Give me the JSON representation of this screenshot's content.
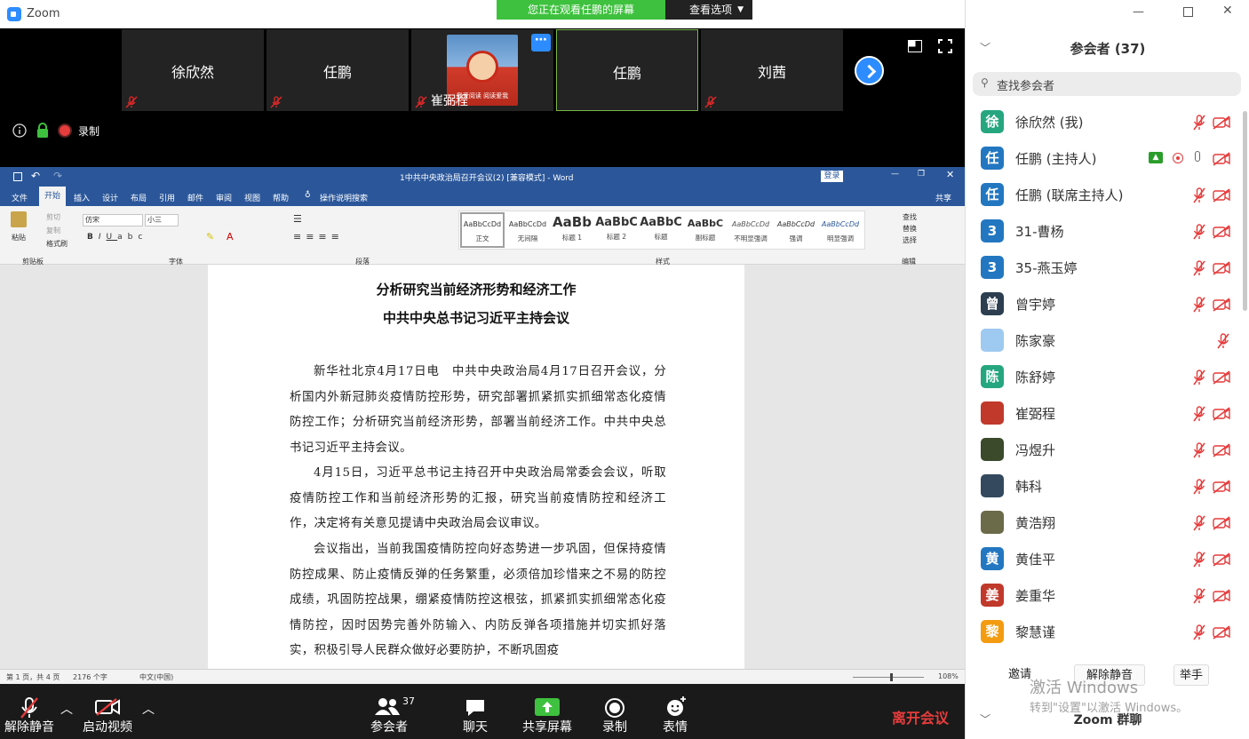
{
  "window": {
    "app_name": "Zoom"
  },
  "share_banner": {
    "text": "您正在观看任鹏的屏幕",
    "view_options": "查看选项"
  },
  "video_tiles": [
    {
      "name": "徐欣然"
    },
    {
      "name": "任鹏"
    },
    {
      "name": "崔弼程",
      "overlay": "我爱阅读 阅读爱我"
    },
    {
      "name": "任鹏"
    },
    {
      "name": "刘茜"
    }
  ],
  "meeting_info": {
    "record_label": "录制"
  },
  "word": {
    "title": "1中共中央政治局召开会议(2) [兼容模式] - Word",
    "login": "登录",
    "share": "共享",
    "tabs": [
      "文件",
      "开始",
      "插入",
      "设计",
      "布局",
      "引用",
      "邮件",
      "审阅",
      "视图",
      "帮助",
      "操作说明搜索"
    ],
    "font_name": "仿宋",
    "font_size": "小三",
    "styles": [
      "正文",
      "无间隔",
      "标题 1",
      "标题 2",
      "标题",
      "副标题",
      "不明显强调",
      "强调",
      "明显强调"
    ],
    "style_previews": [
      "AaBbCcDd",
      "AaBbCcDd",
      "AaBb",
      "AaBbC",
      "AaBbC",
      "AaBbC",
      "AaBbCcDd",
      "AaBbCcDd",
      "AaBbCcDd"
    ],
    "clipboard_items": {
      "paste": "粘贴",
      "cut": "剪切",
      "copy": "复制",
      "painter": "格式刷"
    },
    "groups": {
      "clipboard": "剪贴板",
      "font": "字体",
      "paragraph": "段落",
      "styles": "样式",
      "editing": "编辑"
    },
    "editing_items": [
      "查找",
      "替换",
      "选择"
    ],
    "doc": {
      "title_line1": "分析研究当前经济形势和经济工作",
      "title_line2": "中共中央总书记习近平主持会议",
      "para1": "新华社北京4月17日电　中共中央政治局4月17日召开会议，分析国内外新冠肺炎疫情防控形势，研究部署抓紧抓实抓细常态化疫情防控工作；分析研究当前经济形势，部署当前经济工作。中共中央总书记习近平主持会议。",
      "para2": "4月15日，习近平总书记主持召开中央政治局常委会会议，听取疫情防控工作和当前经济形势的汇报，研究当前疫情防控和经济工作，决定将有关意见提请中央政治局会议审议。",
      "para3": "会议指出，当前我国疫情防控向好态势进一步巩固，但保持疫情防控成果、防止疫情反弹的任务繁重，必须倍加珍惜来之不易的防控成绩，巩固防控战果，绷紧疫情防控这根弦，抓紧抓实抓细常态化疫情防控，因时因势完善外防输入、内防反弹各项措施并切实抓好落实，积极引导人民群众做好必要防护，不断巩固疫"
    },
    "status": {
      "page": "第 1 页，共 4 页",
      "words": "2176 个字",
      "lang": "中文(中国)",
      "zoom": "108%"
    }
  },
  "toolbar": {
    "unmute": "解除静音",
    "start_video": "启动视频",
    "participants": "参会者",
    "participants_count": "37",
    "chat": "聊天",
    "share": "共享屏幕",
    "record": "录制",
    "reactions": "表情",
    "leave": "离开会议"
  },
  "panel": {
    "title": "参会者 (37)",
    "search_placeholder": "查找参会者",
    "participants": [
      {
        "avatar": "徐",
        "name": "徐欣然 (我)",
        "color": "#26a67f"
      },
      {
        "avatar": "任",
        "name": "任鹏 (主持人)",
        "color": "#2377c1"
      },
      {
        "avatar": "任",
        "name": "任鹏 (联席主持人)",
        "color": "#2377c1"
      },
      {
        "avatar": "3",
        "name": "31-曹杨",
        "color": "#2377c1"
      },
      {
        "avatar": "3",
        "name": "35-燕玉婷",
        "color": "#2377c1"
      },
      {
        "avatar": "曾",
        "name": "曾宇婷",
        "color": "#2c3e50"
      },
      {
        "avatar": "",
        "name": "陈家豪",
        "color": "#9ec9f0"
      },
      {
        "avatar": "陈",
        "name": "陈舒婷",
        "color": "#26a67f"
      },
      {
        "avatar": "",
        "name": "崔弼程",
        "color": "#c0392b"
      },
      {
        "avatar": "",
        "name": "冯煜升",
        "color": "#3a4a2a"
      },
      {
        "avatar": "",
        "name": "韩科",
        "color": "#34495e"
      },
      {
        "avatar": "",
        "name": "黄浩翔",
        "color": "#6b6b4a"
      },
      {
        "avatar": "黄",
        "name": "黄佳平",
        "color": "#2377c1"
      },
      {
        "avatar": "姜",
        "name": "姜重华",
        "color": "#c0392b"
      },
      {
        "avatar": "黎",
        "name": "黎慧谨",
        "color": "#f39c12"
      }
    ],
    "invite": "邀请",
    "unmute_all": "解除静音",
    "raise_hand": "举手",
    "chat_title": "Zoom 群聊",
    "watermark1": "激活 Windows",
    "watermark2": "转到\"设置\"以激活 Windows。"
  }
}
